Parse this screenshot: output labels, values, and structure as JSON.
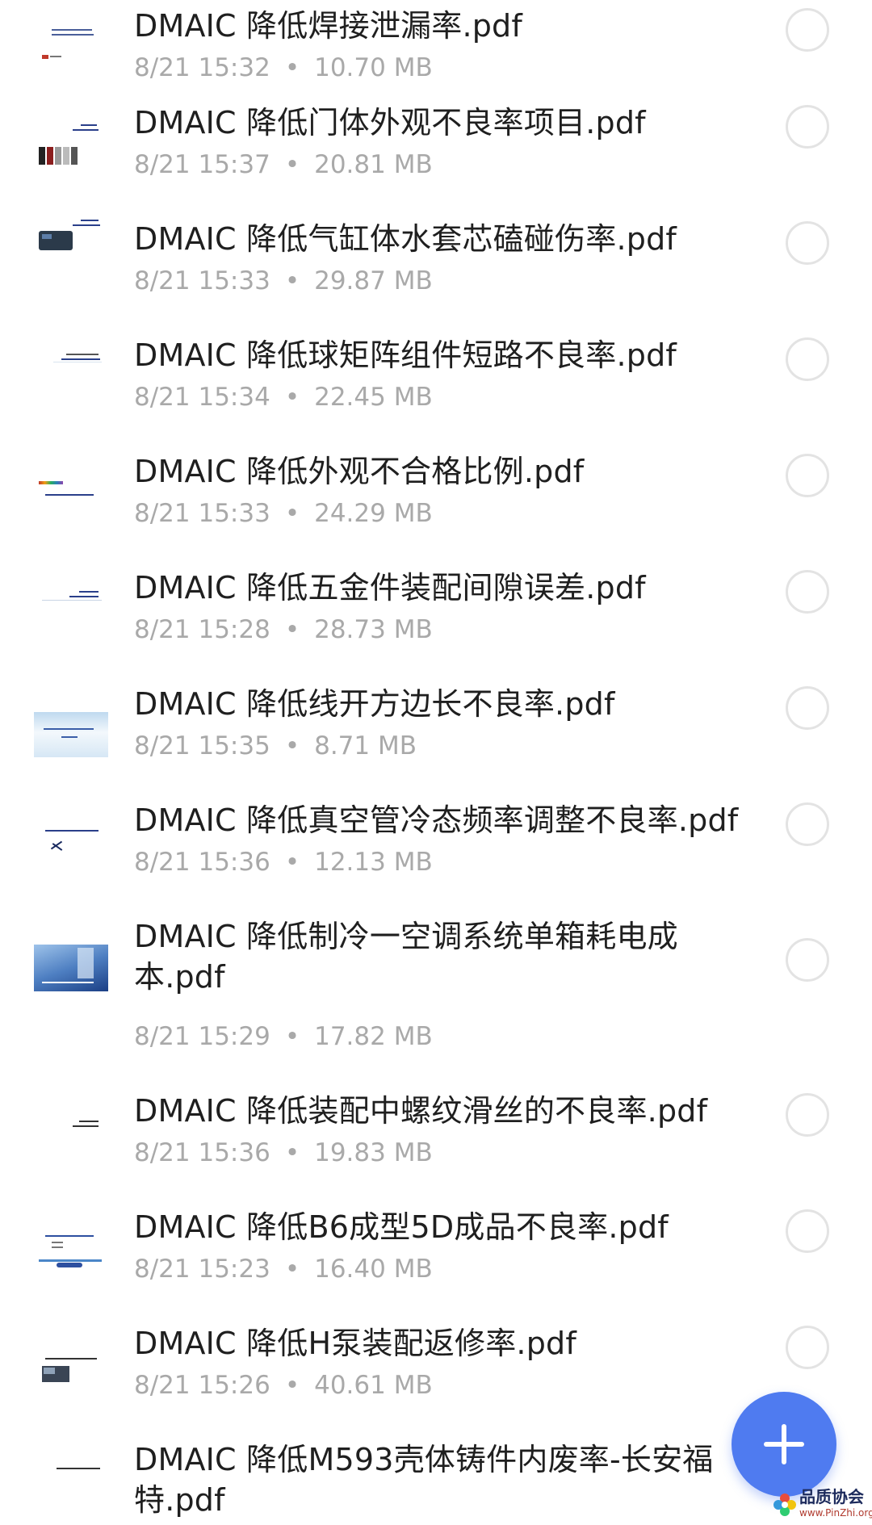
{
  "files": [
    {
      "name": "DMAIC 降低焊接泄漏率.pdf",
      "time": "8/21 15:32",
      "size": "10.70 MB"
    },
    {
      "name": "DMAIC 降低门体外观不良率项目.pdf",
      "time": "8/21 15:37",
      "size": "20.81 MB"
    },
    {
      "name": "DMAIC 降低气缸体水套芯磕碰伤率.pdf",
      "time": "8/21 15:33",
      "size": "29.87 MB"
    },
    {
      "name": "DMAIC 降低球矩阵组件短路不良率.pdf",
      "time": "8/21 15:34",
      "size": "22.45 MB"
    },
    {
      "name": "DMAIC 降低外观不合格比例.pdf",
      "time": "8/21 15:33",
      "size": "24.29 MB"
    },
    {
      "name": "DMAIC 降低五金件装配间隙误差.pdf",
      "time": "8/21 15:28",
      "size": "28.73 MB"
    },
    {
      "name": "DMAIC 降低线开方边长不良率.pdf",
      "time": "8/21 15:35",
      "size": "8.71 MB"
    },
    {
      "name": "DMAIC 降低真空管冷态频率调整不良率.pdf",
      "time": "8/21 15:36",
      "size": "12.13 MB"
    },
    {
      "name": "DMAIC 降低制冷一空调系统单箱耗电成本.pdf",
      "time": "8/21 15:29",
      "size": "17.82 MB"
    },
    {
      "name": "DMAIC 降低装配中螺纹滑丝的不良率.pdf",
      "time": "8/21 15:36",
      "size": "19.83 MB"
    },
    {
      "name": "DMAIC 降低B6成型5D成品不良率.pdf",
      "time": "8/21 15:23",
      "size": "16.40 MB"
    },
    {
      "name": "DMAIC 降低H泵装配返修率.pdf",
      "time": "8/21 15:26",
      "size": "40.61 MB"
    },
    {
      "name": "DMAIC 降低M593壳体铸件内废率-长安福特.pdf",
      "time": "",
      "size": ""
    }
  ],
  "meta_separator": "•",
  "fab": {
    "icon": "plus-icon",
    "color": "#4f7bf0"
  },
  "watermark": {
    "text": "品质协会",
    "url": "www.PinZhi.org"
  },
  "colors": {
    "title": "#1f1f1f",
    "meta": "#a9a9a9",
    "check_border": "#e3e3e3",
    "accent": "#4f7bf0"
  }
}
